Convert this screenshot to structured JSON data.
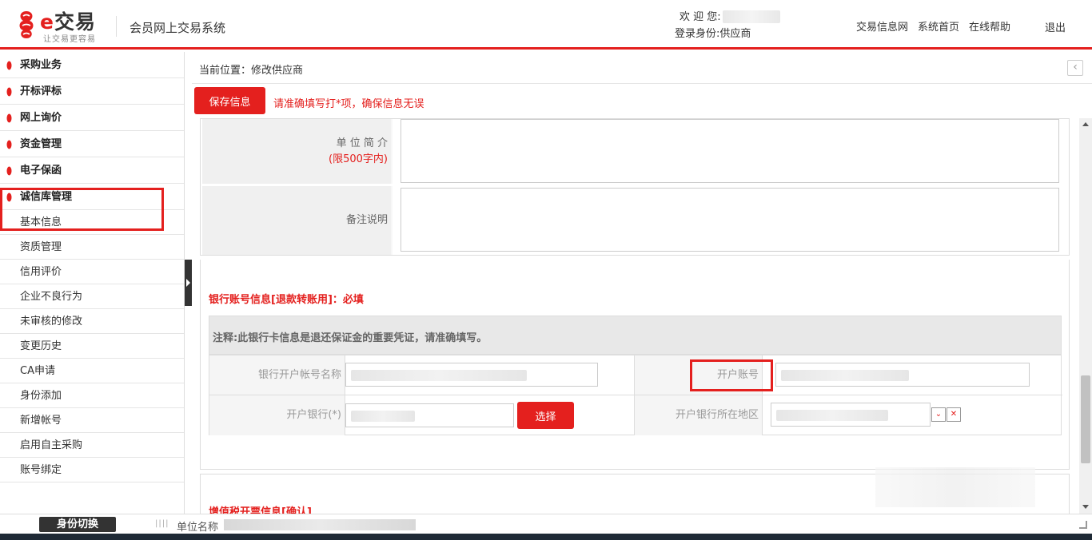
{
  "header": {
    "logo_e": "e",
    "logo_text": "交易",
    "logo_slogan": "让交易更容易",
    "system_title": "会员网上交易系统",
    "welcome_label": "欢 迎 您:",
    "identity_label": "登录身份:",
    "identity_value": "供应商",
    "links": [
      "交易信息网",
      "系统首页",
      "在线帮助"
    ],
    "logout": "退出"
  },
  "sidebar": {
    "menus": [
      "采购业务",
      "开标评标",
      "网上询价",
      "资金管理",
      "电子保函",
      "诚信库管理"
    ],
    "sub_items": [
      "基本信息",
      "资质管理",
      "信用评价",
      "企业不良行为",
      "未审核的修改",
      "变更历史",
      "CA申请",
      "身份添加",
      "新增帐号",
      "启用自主采购",
      "账号绑定"
    ]
  },
  "main": {
    "breadcrumb": "当前位置：修改供应商",
    "back_icon": "‹",
    "save_button": "保存信息",
    "tip": "请准确填写打*项，确保信息无误",
    "intro_label": "单 位 简 介",
    "intro_limit": "(限500字内)",
    "remark_label": "备注说明",
    "bank_title": "银行账号信息[退款转账用]：必填",
    "bank_note": "注释:此银行卡信息是退还保证金的重要凭证，请准确填写。",
    "bank_name_label": "银行开户帐号名称",
    "account_label": "开户账号",
    "bank_label": "开户银行(*)",
    "choose_button": "选择",
    "region_label": "开户银行所在地区",
    "dropdown_icon": "⌄",
    "clear_icon": "✕",
    "vat_title": "增值税开票信息[确认]"
  },
  "footer": {
    "switch_button": "身份切换",
    "separator": "||||",
    "unit_label": "单位名称"
  },
  "colors": {
    "accent": "#e4201e",
    "dark": "#333333"
  }
}
